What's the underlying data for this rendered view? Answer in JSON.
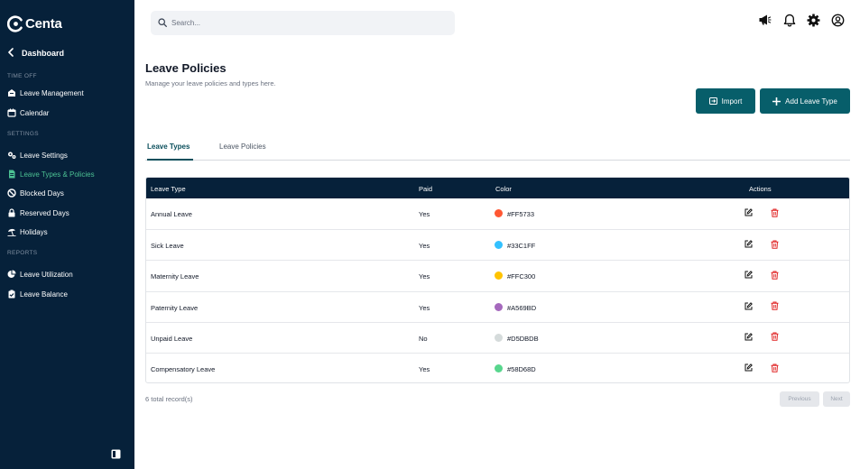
{
  "brand": {
    "name": "Centa"
  },
  "sidebar": {
    "back_label": "Dashboard",
    "sections": [
      {
        "title": "TIME OFF",
        "items": [
          {
            "label": "Leave Management",
            "icon": "inbox-icon",
            "active": false
          },
          {
            "label": "Calendar",
            "icon": "calendar-icon",
            "active": false
          }
        ]
      },
      {
        "title": "SETTINGS",
        "items": [
          {
            "label": "Leave Settings",
            "icon": "gears-icon",
            "active": false
          },
          {
            "label": "Leave Types & Policies",
            "icon": "document-icon",
            "active": true
          },
          {
            "label": "Blocked Days",
            "icon": "ban-icon",
            "active": false
          },
          {
            "label": "Reserved Days",
            "icon": "lock-icon",
            "active": false
          },
          {
            "label": "Holidays",
            "icon": "beach-umbrella-icon",
            "active": false
          }
        ]
      },
      {
        "title": "REPORTS",
        "items": [
          {
            "label": "Leave Utilization",
            "icon": "pie-chart-icon",
            "active": false
          },
          {
            "label": "Leave Balance",
            "icon": "clipboard-check-icon",
            "active": false
          }
        ]
      }
    ]
  },
  "search": {
    "placeholder": "Search..."
  },
  "header": {
    "title": "Leave Policies",
    "subtitle": "Manage your leave policies and types here.",
    "import_label": "Import",
    "add_label": "Add Leave Type"
  },
  "tabs": [
    {
      "label": "Leave Types",
      "active": true
    },
    {
      "label": "Leave Policies",
      "active": false
    }
  ],
  "table": {
    "columns": [
      "Leave Type",
      "Paid",
      "Color",
      "Actions"
    ],
    "rows": [
      {
        "name": "Annual Leave",
        "paid": "Yes",
        "color": "#FF5733"
      },
      {
        "name": "Sick Leave",
        "paid": "Yes",
        "color": "#33C1FF"
      },
      {
        "name": "Maternity Leave",
        "paid": "Yes",
        "color": "#FFC300"
      },
      {
        "name": "Paternity Leave",
        "paid": "Yes",
        "color": "#A569BD"
      },
      {
        "name": "Unpaid Leave",
        "paid": "No",
        "color": "#D5DBDB"
      },
      {
        "name": "Compensatory Leave",
        "paid": "Yes",
        "color": "#58D68D"
      }
    ]
  },
  "footer": {
    "total": "6 total record(s)",
    "previous_label": "Previous",
    "next_label": "Next"
  },
  "colors": {
    "sidebar_bg": "#06213a",
    "accent": "#075e6a",
    "active_nav": "#4cc193",
    "danger": "#e02424"
  }
}
